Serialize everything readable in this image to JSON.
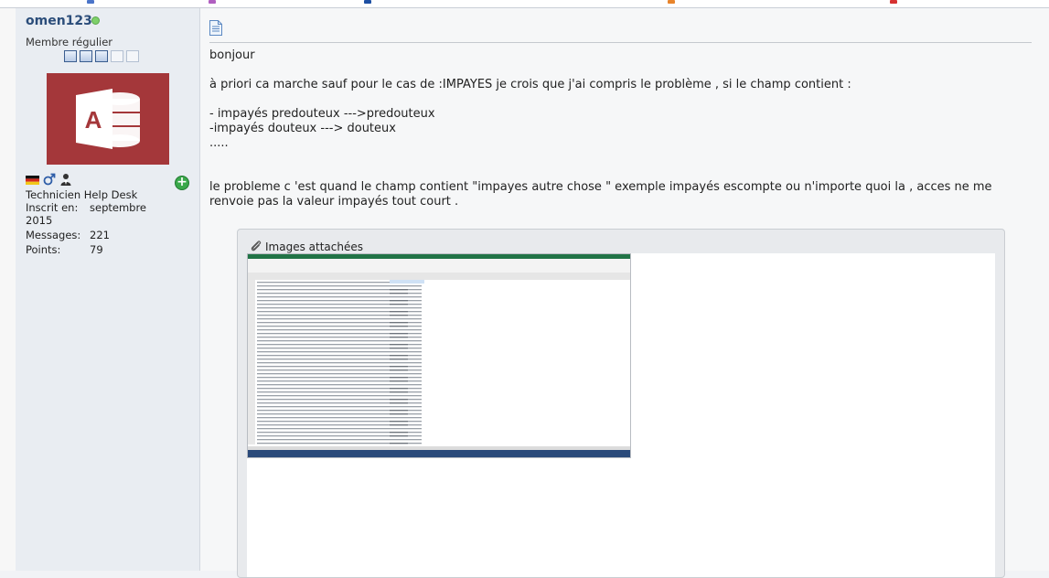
{
  "user": {
    "username": "omen123",
    "online_status_color": "#7ed06a",
    "title": "Membre régulier",
    "reputation": {
      "filled": 3,
      "total": 5
    },
    "avatar": {
      "app_icon": "access-icon",
      "letter": "A",
      "background": "#a4373a"
    },
    "badges": [
      "german-flag-icon",
      "male-gender-icon",
      "user-icon"
    ],
    "rank": "Technicien Help Desk",
    "stats": [
      {
        "label": "Inscrit en:",
        "value": "septembre",
        "value_wrap": "2015"
      },
      {
        "label": "Messages:",
        "value": "221"
      },
      {
        "label": "Points:",
        "value": "79"
      }
    ]
  },
  "post": {
    "lines": [
      "bonjour",
      "",
      "à priori ca marche sauf pour le cas de :IMPAYES je crois que j'ai compris le problème , si le champ contient :",
      "",
      "- impayés predouteux --->predouteux",
      "-impayés douteux ---> douteux",
      ".....",
      "",
      "",
      "le probleme c 'est quand le champ contient \"impayes autre chose \" exemple impayés escompte ou n'importe quoi la , acces ne me renvoie pas la valeur impayés tout court ."
    ],
    "attachments_title": "Images attachées"
  },
  "colors": {
    "accent": "#2b4d7a",
    "access_red": "#a4373a",
    "excel_green": "#217346",
    "add_green": "#3aa84a"
  }
}
